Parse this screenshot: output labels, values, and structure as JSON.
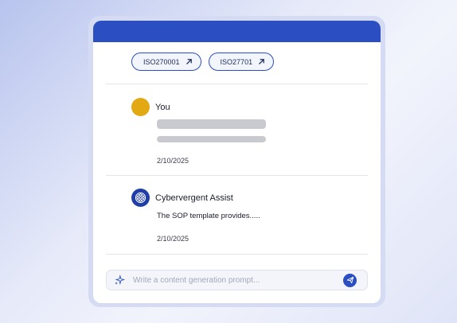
{
  "refs": [
    {
      "label": "ISO270001",
      "icon": "arrow-up-right-icon"
    },
    {
      "label": "ISO27701",
      "icon": "arrow-up-right-icon"
    }
  ],
  "messages": [
    {
      "sender": "You",
      "date": "2/10/2025",
      "avatar_color": "#e2a913"
    },
    {
      "sender": "Cybervergent Assist",
      "text": "The SOP template provides.....",
      "date": "2/10/2025",
      "avatar_color": "#1f3ea8"
    }
  ],
  "composer": {
    "placeholder": "Write a content generation prompt...",
    "value": ""
  },
  "colors": {
    "accent": "#2b4fc2",
    "header": "#2b4fc2"
  }
}
